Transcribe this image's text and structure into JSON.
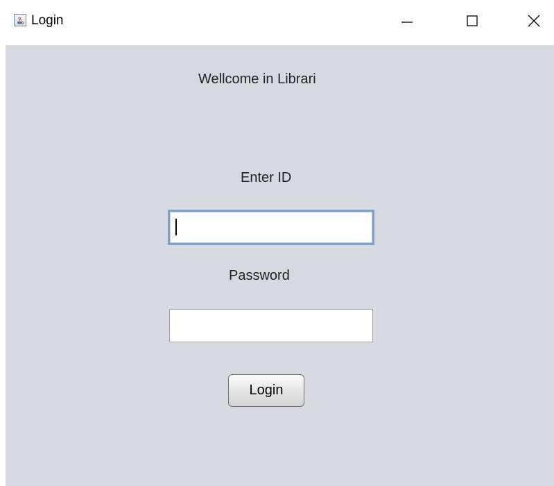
{
  "window": {
    "title": "Login",
    "app_icon": "java-coffee-cup-icon",
    "controls": {
      "minimize_icon": "minimize-icon",
      "maximize_icon": "maximize-icon",
      "close_icon": "close-icon"
    }
  },
  "form": {
    "welcome_text": "Wellcome in Librari",
    "id_label": "Enter ID",
    "id_value": "",
    "password_label": "Password",
    "password_value": "",
    "login_button_label": "Login"
  },
  "colors": {
    "background": "#d6d9df",
    "titlebar": "#ffffff",
    "focus_border": "#7fa0c8"
  }
}
